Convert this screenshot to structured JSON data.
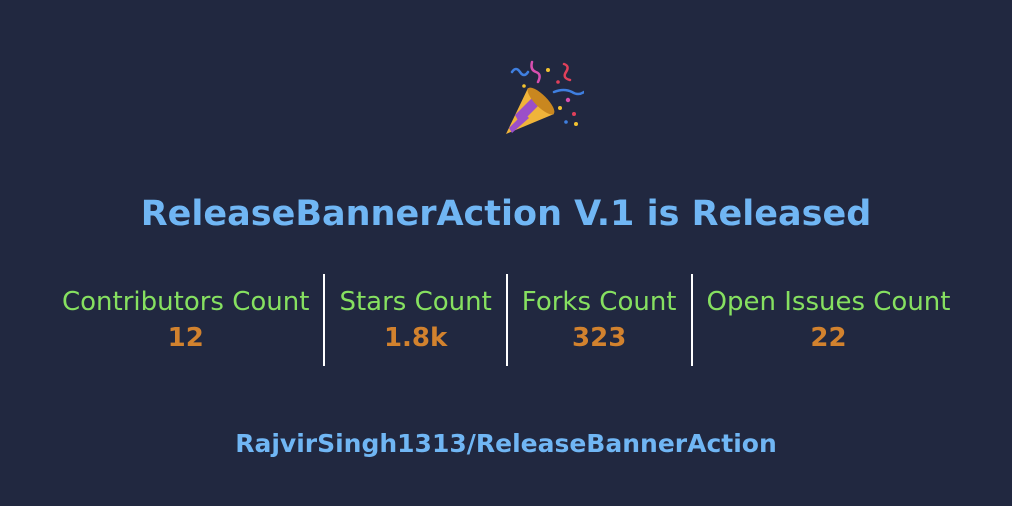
{
  "header": {
    "icon": "party-popper-icon"
  },
  "title": "ReleaseBannerAction V.1 is Released",
  "stats": [
    {
      "label": "Contributors Count",
      "value": "12"
    },
    {
      "label": "Stars Count",
      "value": "1.8k"
    },
    {
      "label": "Forks Count",
      "value": "323"
    },
    {
      "label": "Open Issues Count",
      "value": "22"
    }
  ],
  "repo": "RajvirSingh1313/ReleaseBannerAction",
  "colors": {
    "background": "#212840",
    "title": "#70b6f4",
    "label": "#86e060",
    "value": "#d2822e",
    "divider": "#ffffff"
  }
}
